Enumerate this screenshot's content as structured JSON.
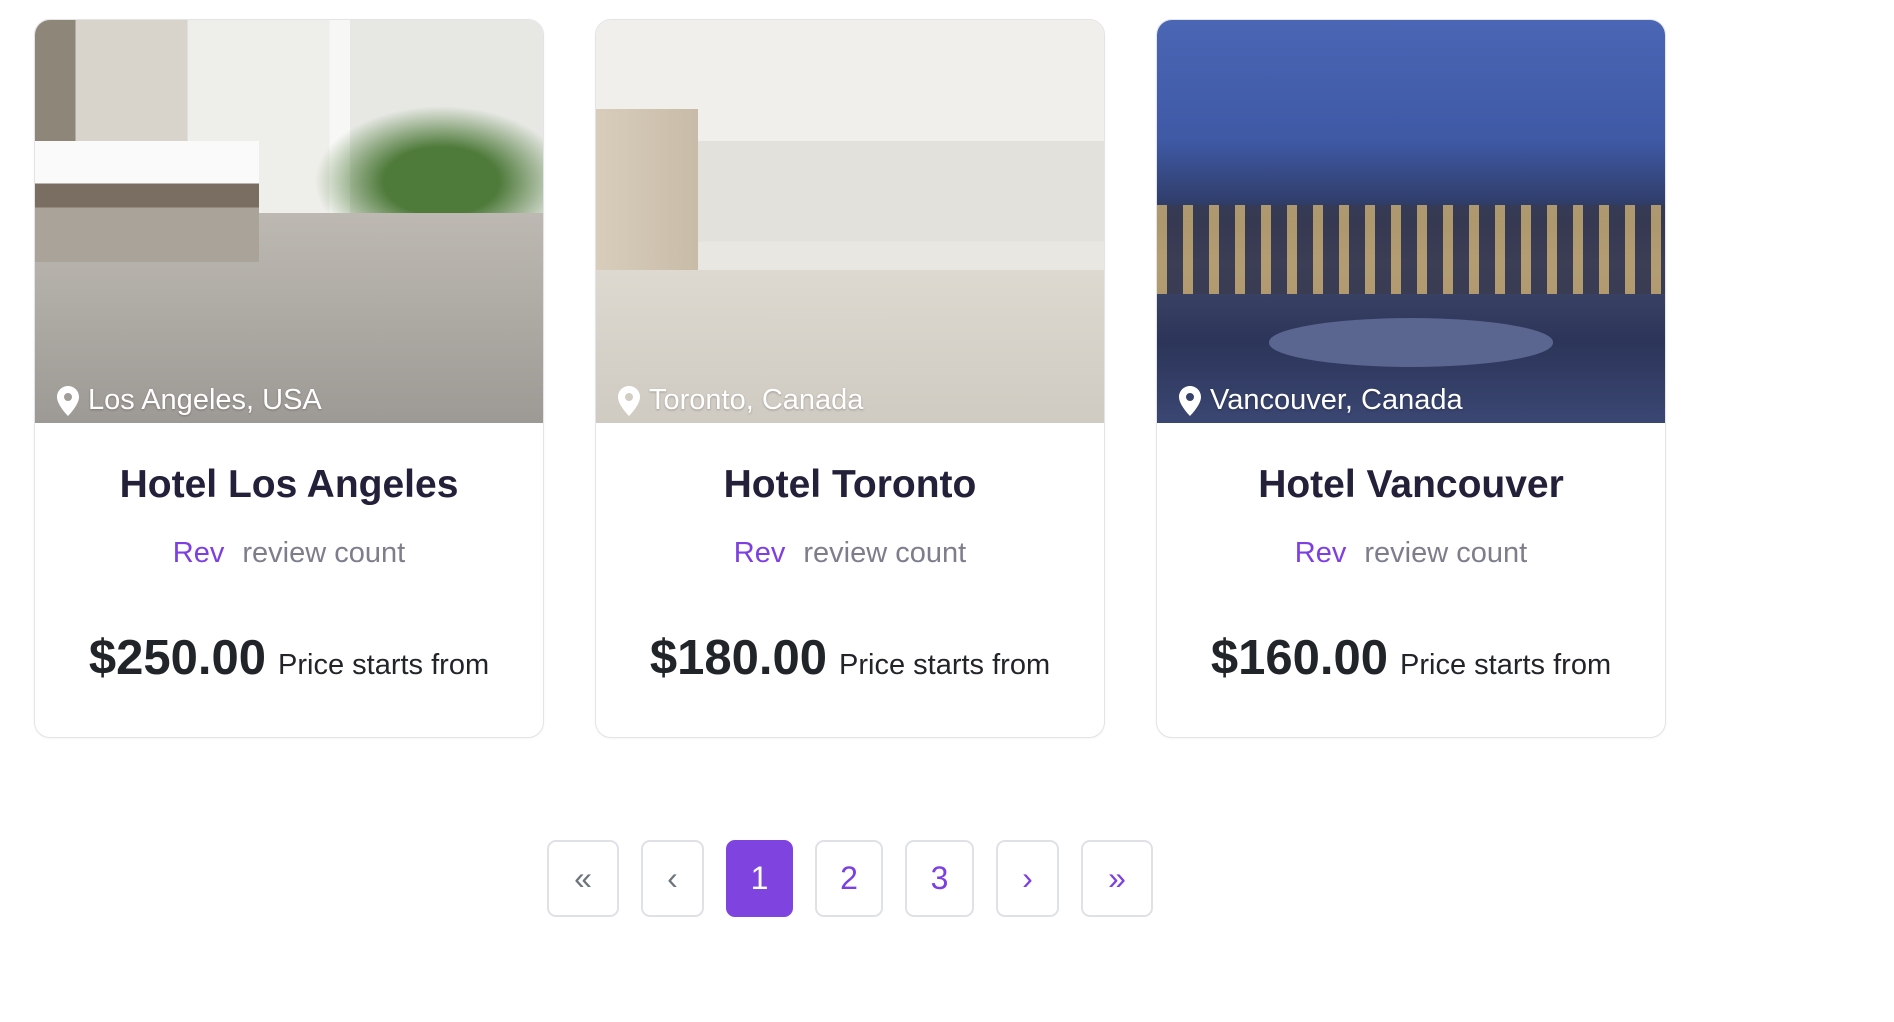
{
  "hotels": [
    {
      "location": "Los Angeles, USA",
      "name": "Hotel Los Angeles",
      "rating_label": "Rev",
      "review_label": "review count",
      "price": "$250.00",
      "price_label": "Price starts from"
    },
    {
      "location": "Toronto, Canada",
      "name": "Hotel Toronto",
      "rating_label": "Rev",
      "review_label": "review count",
      "price": "$180.00",
      "price_label": "Price starts from"
    },
    {
      "location": "Vancouver, Canada",
      "name": "Hotel Vancouver",
      "rating_label": "Rev",
      "review_label": "review count",
      "price": "$160.00",
      "price_label": "Price starts from"
    }
  ],
  "pagination": {
    "first": "«",
    "prev": "‹",
    "pages": [
      "1",
      "2",
      "3"
    ],
    "current": "1",
    "next": "›",
    "last": "»"
  },
  "colors": {
    "accent": "#7f44e0",
    "title": "#23203a",
    "muted": "#7e7d8c"
  }
}
